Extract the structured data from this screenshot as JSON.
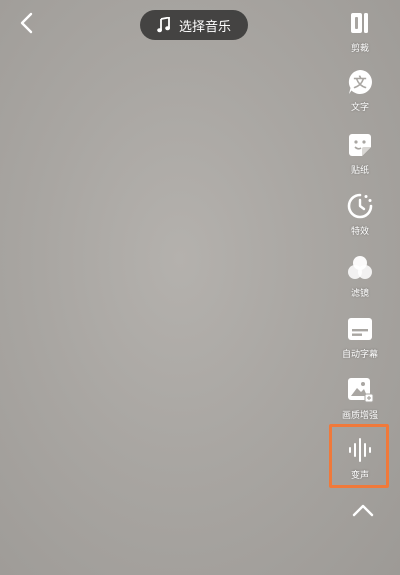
{
  "header": {
    "back_icon": "chevron-left-icon",
    "music_icon": "music-note-icon",
    "music_label": "选择音乐"
  },
  "toolbar": {
    "items": [
      {
        "label": "剪裁",
        "icon": "trim-icon"
      },
      {
        "label": "文字",
        "icon": "text-icon"
      },
      {
        "label": "贴纸",
        "icon": "sticker-icon"
      },
      {
        "label": "特效",
        "icon": "effects-icon"
      },
      {
        "label": "滤镜",
        "icon": "filter-icon"
      },
      {
        "label": "自动字幕",
        "icon": "auto-subtitle-icon"
      },
      {
        "label": "画质增强",
        "icon": "quality-enhance-icon"
      },
      {
        "label": "变声",
        "icon": "voice-change-icon"
      }
    ],
    "expand_icon": "chevron-up-icon",
    "highlight_color": "#f0793a"
  }
}
